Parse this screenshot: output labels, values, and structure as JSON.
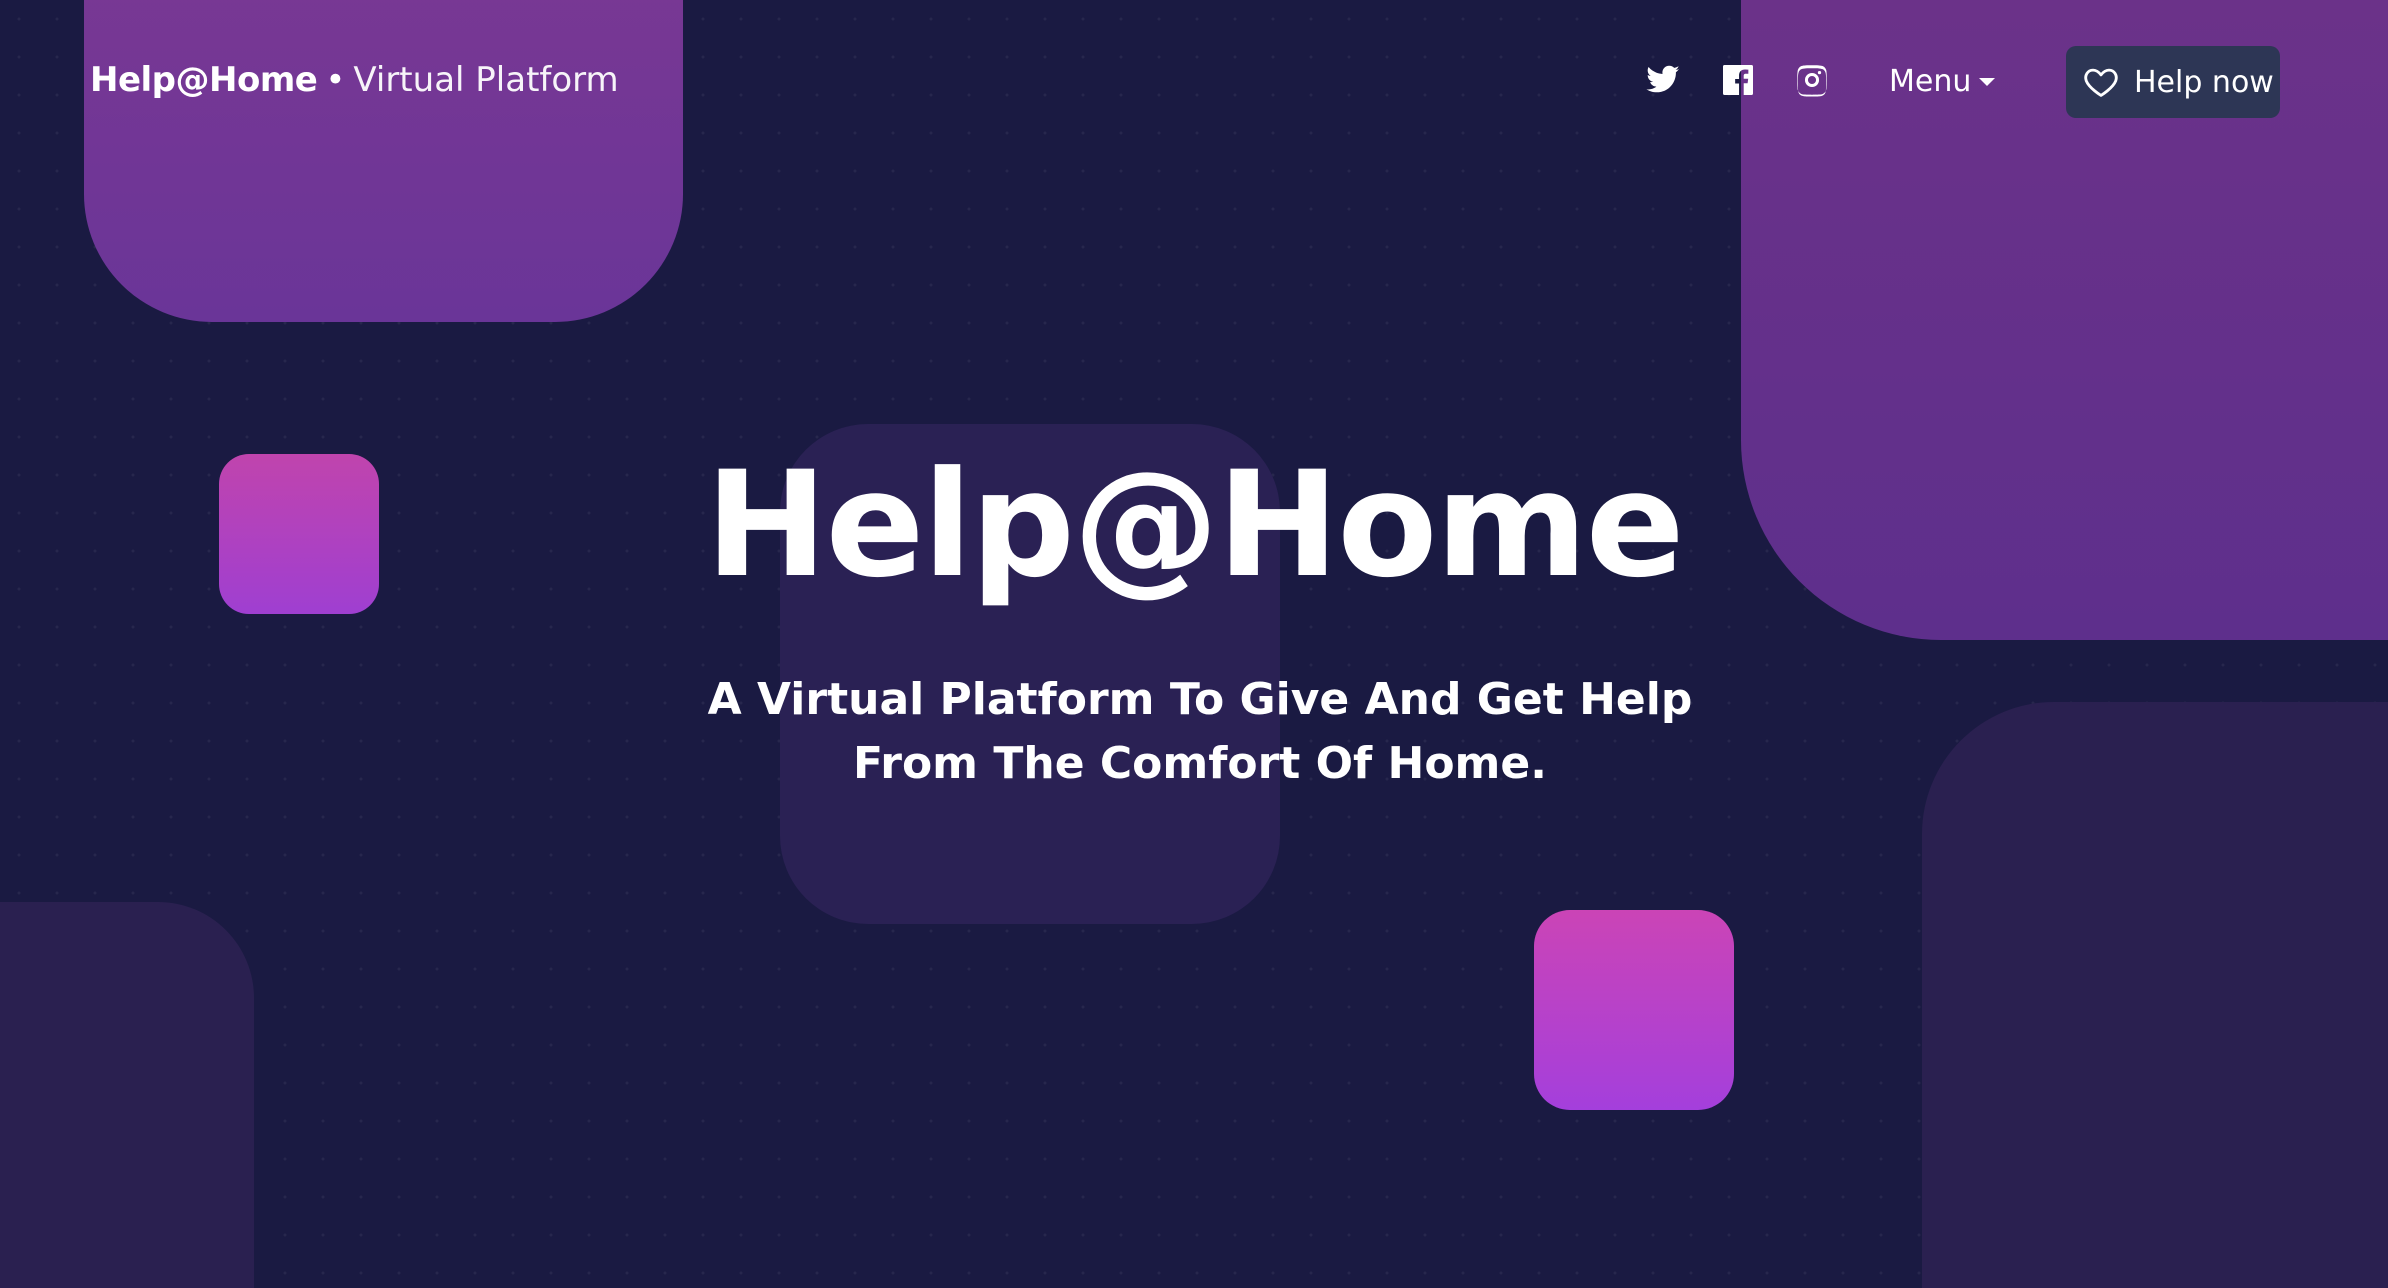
{
  "header": {
    "brand_name": "Help@Home",
    "brand_separator": "•",
    "brand_tagline": "Virtual Platform",
    "social": [
      {
        "icon": "twitter-icon"
      },
      {
        "icon": "facebook-icon"
      },
      {
        "icon": "instagram-icon"
      }
    ],
    "menu_label": "Menu",
    "help_button_label": "Help now",
    "help_button_icon": "heart-icon"
  },
  "hero": {
    "title": "Help@Home",
    "subtitle_line1": "A Virtual Platform To Give And Get Help",
    "subtitle_line2": "From The Comfort Of Home."
  },
  "colors": {
    "background": "#1a1a42",
    "accent_purple": "#7a3893",
    "accent_pink": "#c044ad",
    "button_bg": "#2d3655"
  }
}
